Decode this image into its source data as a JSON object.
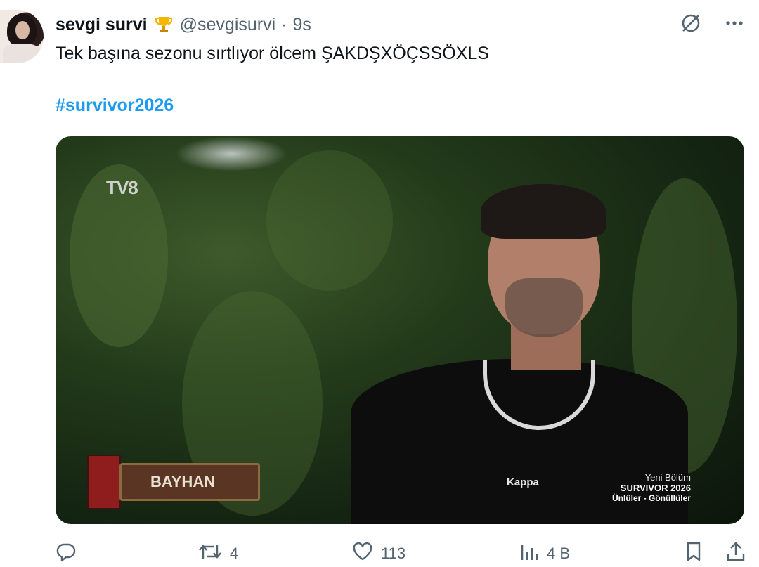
{
  "author": {
    "display_name": "sevgi survi",
    "handle": "@sevgisurvi",
    "separator": "·",
    "time": "9s"
  },
  "tweet": {
    "text": "Tek başına sezonu sırtlıyor ölcem ŞAKDŞXÖÇSSÖXLS",
    "hashtag": "#survivor2026"
  },
  "media": {
    "channel_logo": "TV8",
    "name_tag": "BAYHAN",
    "shirt_brand": "Kappa",
    "promo_line1": "Yeni Bölüm",
    "promo_line2": "SURVIVOR 2026",
    "promo_line3": "Ünlüler - Gönüllüler"
  },
  "actions": {
    "reply_count": "",
    "retweet_count": "4",
    "like_count": "113",
    "views_count": "4 B"
  },
  "icons": {
    "reply": "reply-icon",
    "retweet": "retweet-icon",
    "like": "heart-icon",
    "views": "analytics-icon",
    "bookmark": "bookmark-icon",
    "share": "share-icon",
    "grok": "grok-icon",
    "more": "more-icon"
  },
  "colors": {
    "accent": "#1d9bf0",
    "muted": "#536471",
    "text": "#0f1419"
  }
}
